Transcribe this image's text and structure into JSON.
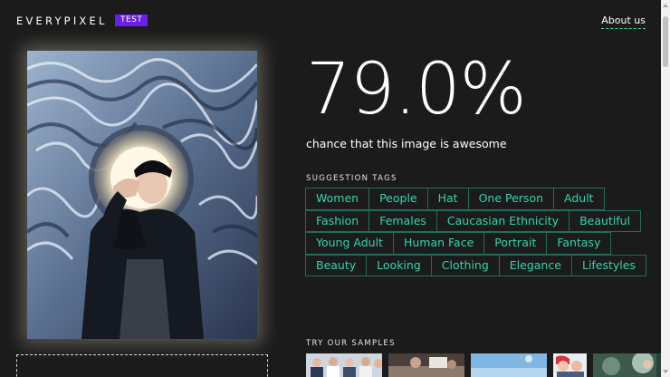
{
  "header": {
    "logo": "EVERYPIXEL",
    "badge": "TEST",
    "about_link": "About us"
  },
  "result": {
    "score": "79.0%",
    "description": "chance that this image is awesome"
  },
  "tags_section": {
    "title": "SUGGESTION TAGS",
    "tags": [
      "Women",
      "People",
      "Hat",
      "One Person",
      "Adult",
      "Fashion",
      "Females",
      "Caucasian Ethnicity",
      "Beautiful",
      "Young Adult",
      "Human Face",
      "Portrait",
      "Fantasy",
      "Beauty",
      "Looking",
      "Clothing",
      "Elegance",
      "Lifestyles"
    ]
  },
  "samples_section": {
    "title": "TRY OUR SAMPLES",
    "samples": [
      "group-photo",
      "office-photo",
      "sky-photo",
      "couple-photo",
      "nature-photo"
    ]
  },
  "colors": {
    "background": "#1b1b1b",
    "accent": "#2fd6ac",
    "tag_border": "#1e6e58",
    "badge": "#6a1fe8"
  }
}
